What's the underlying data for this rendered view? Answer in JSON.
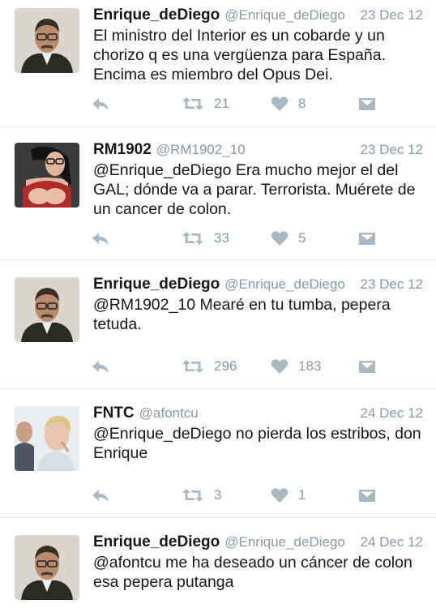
{
  "tweets": [
    {
      "name": "Enrique_deDiego",
      "handle": "@Enrique_deDiego",
      "date": "23 Dec 12",
      "text": "El ministro del Interior es un cobarde y un chorizo q es una vergüenza para España. Encima es miembro del Opus Dei.",
      "retweets": "21",
      "likes": "8"
    },
    {
      "name": "RM1902",
      "handle": "@RM1902_10",
      "date": "23 Dec 12",
      "text": "@Enrique_deDiego Era mucho mejor el del GAL; dónde va a parar. Terrorista. Muérete de un cancer de colon.",
      "retweets": "33",
      "likes": "5"
    },
    {
      "name": "Enrique_deDiego",
      "handle": "@Enrique_deDiego",
      "date": "23 Dec 12",
      "text": "@RM1902_10 Mearé en tu tumba, pepera tetuda.",
      "retweets": "296",
      "likes": "183"
    },
    {
      "name": "FNTC",
      "handle": "@afontcu",
      "date": "24 Dec 12",
      "text": "@Enrique_deDiego no pierda los estribos, don Enrique",
      "retweets": "3",
      "likes": "1"
    },
    {
      "name": "Enrique_deDiego",
      "handle": "@Enrique_deDiego",
      "date": "24 Dec 12",
      "text": "@afontcu me ha deseado un cáncer de colon esa pepera putanga",
      "retweets": "",
      "likes": ""
    }
  ],
  "icons": {
    "reply": "reply-icon",
    "retweet": "retweet-icon",
    "like": "heart-icon",
    "dm": "direct-message-icon"
  },
  "colors": {
    "icon_gray": "#aab8c2",
    "muted_text": "#8899a6",
    "divider": "#e1e8ed"
  }
}
